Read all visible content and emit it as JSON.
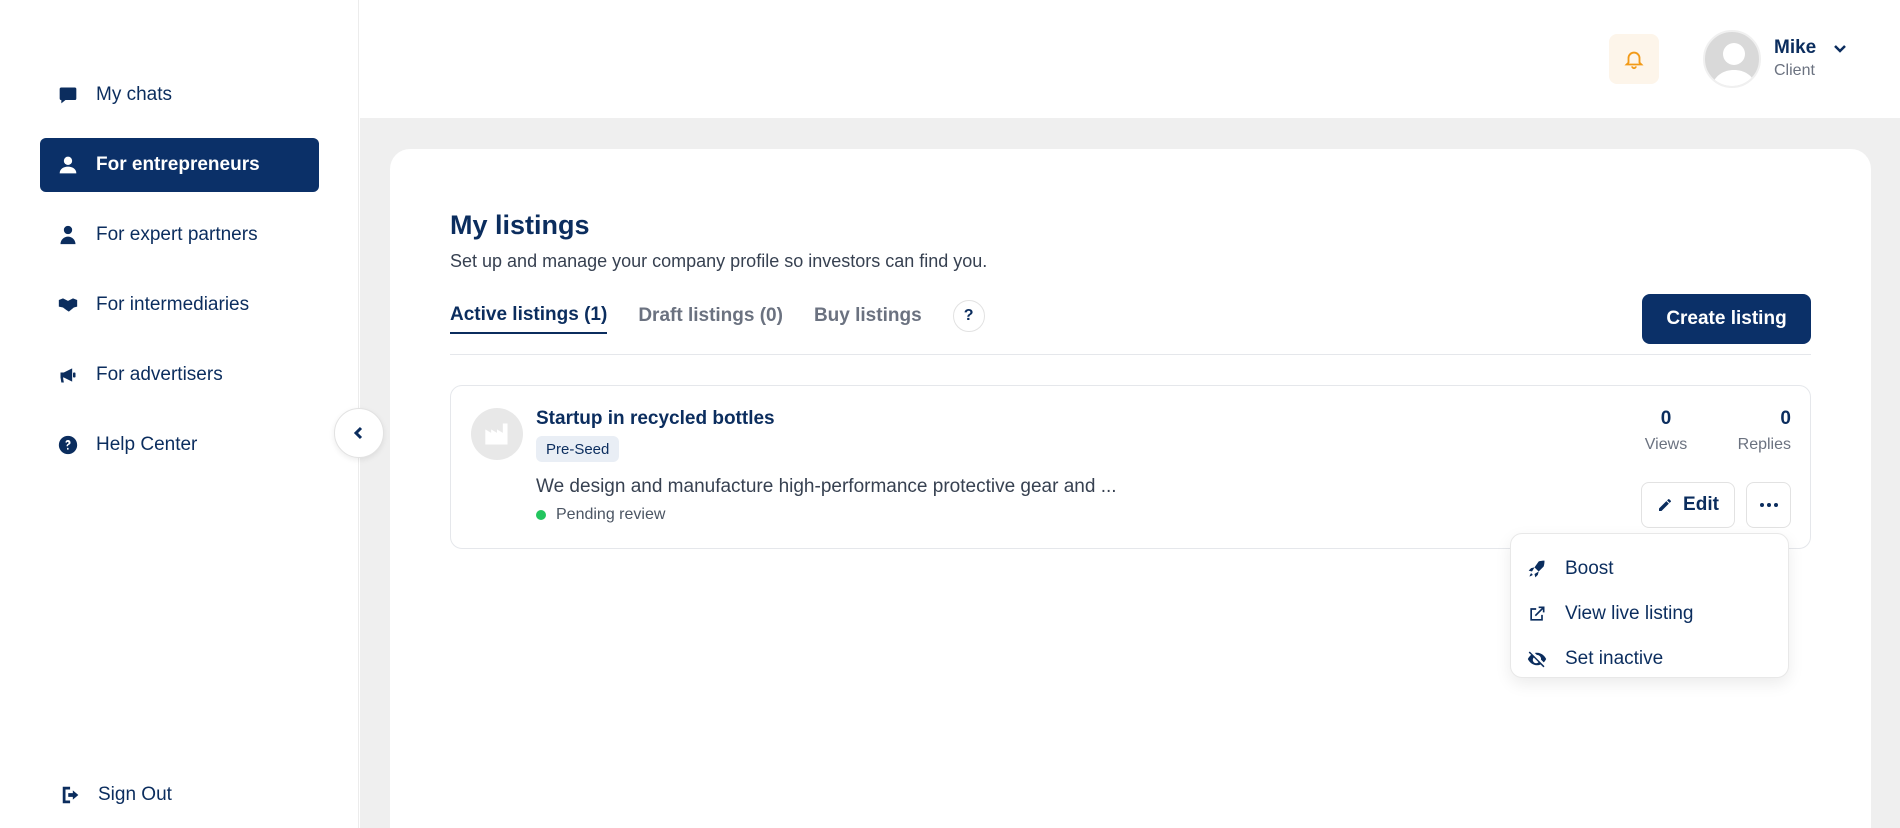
{
  "sidebar": {
    "items": [
      {
        "label": "My chats",
        "icon": "chat-icon",
        "active": false
      },
      {
        "label": "For entrepreneurs",
        "icon": "person-icon",
        "active": true
      },
      {
        "label": "For expert partners",
        "icon": "expert-icon",
        "active": false
      },
      {
        "label": "For intermediaries",
        "icon": "handshake-icon",
        "active": false
      },
      {
        "label": "For advertisers",
        "icon": "megaphone-icon",
        "active": false
      },
      {
        "label": "Help Center",
        "icon": "help-circle-icon",
        "active": false
      }
    ],
    "sign_out_label": "Sign Out"
  },
  "header": {
    "user": {
      "name": "Mike",
      "role": "Client"
    }
  },
  "main": {
    "title": "My listings",
    "subtitle": "Set up and manage your company profile so investors can find you.",
    "tabs": [
      {
        "label": "Active listings (1)",
        "active": true
      },
      {
        "label": "Draft listings (0)",
        "active": false
      },
      {
        "label": "Buy listings",
        "active": false
      }
    ],
    "help_label": "?",
    "create_button_label": "Create listing",
    "listing": {
      "title": "Startup in recycled bottles",
      "stage": "Pre-Seed",
      "description": "We design and manufacture high-performance protective gear and ...",
      "status": "Pending review",
      "views": "0",
      "views_label": "Views",
      "replies": "0",
      "replies_label": "Replies",
      "edit_label": "Edit"
    },
    "menu": {
      "items": [
        {
          "label": "Boost",
          "icon": "rocket-icon"
        },
        {
          "label": "View live listing",
          "icon": "external-link-icon"
        },
        {
          "label": "Set inactive",
          "icon": "eye-slash-icon"
        }
      ]
    }
  },
  "colors": {
    "primary": "#0b3068",
    "text": "#0b2d5e",
    "bell": "#f29a17",
    "status_green": "#22c55e",
    "background": "#efefef"
  }
}
